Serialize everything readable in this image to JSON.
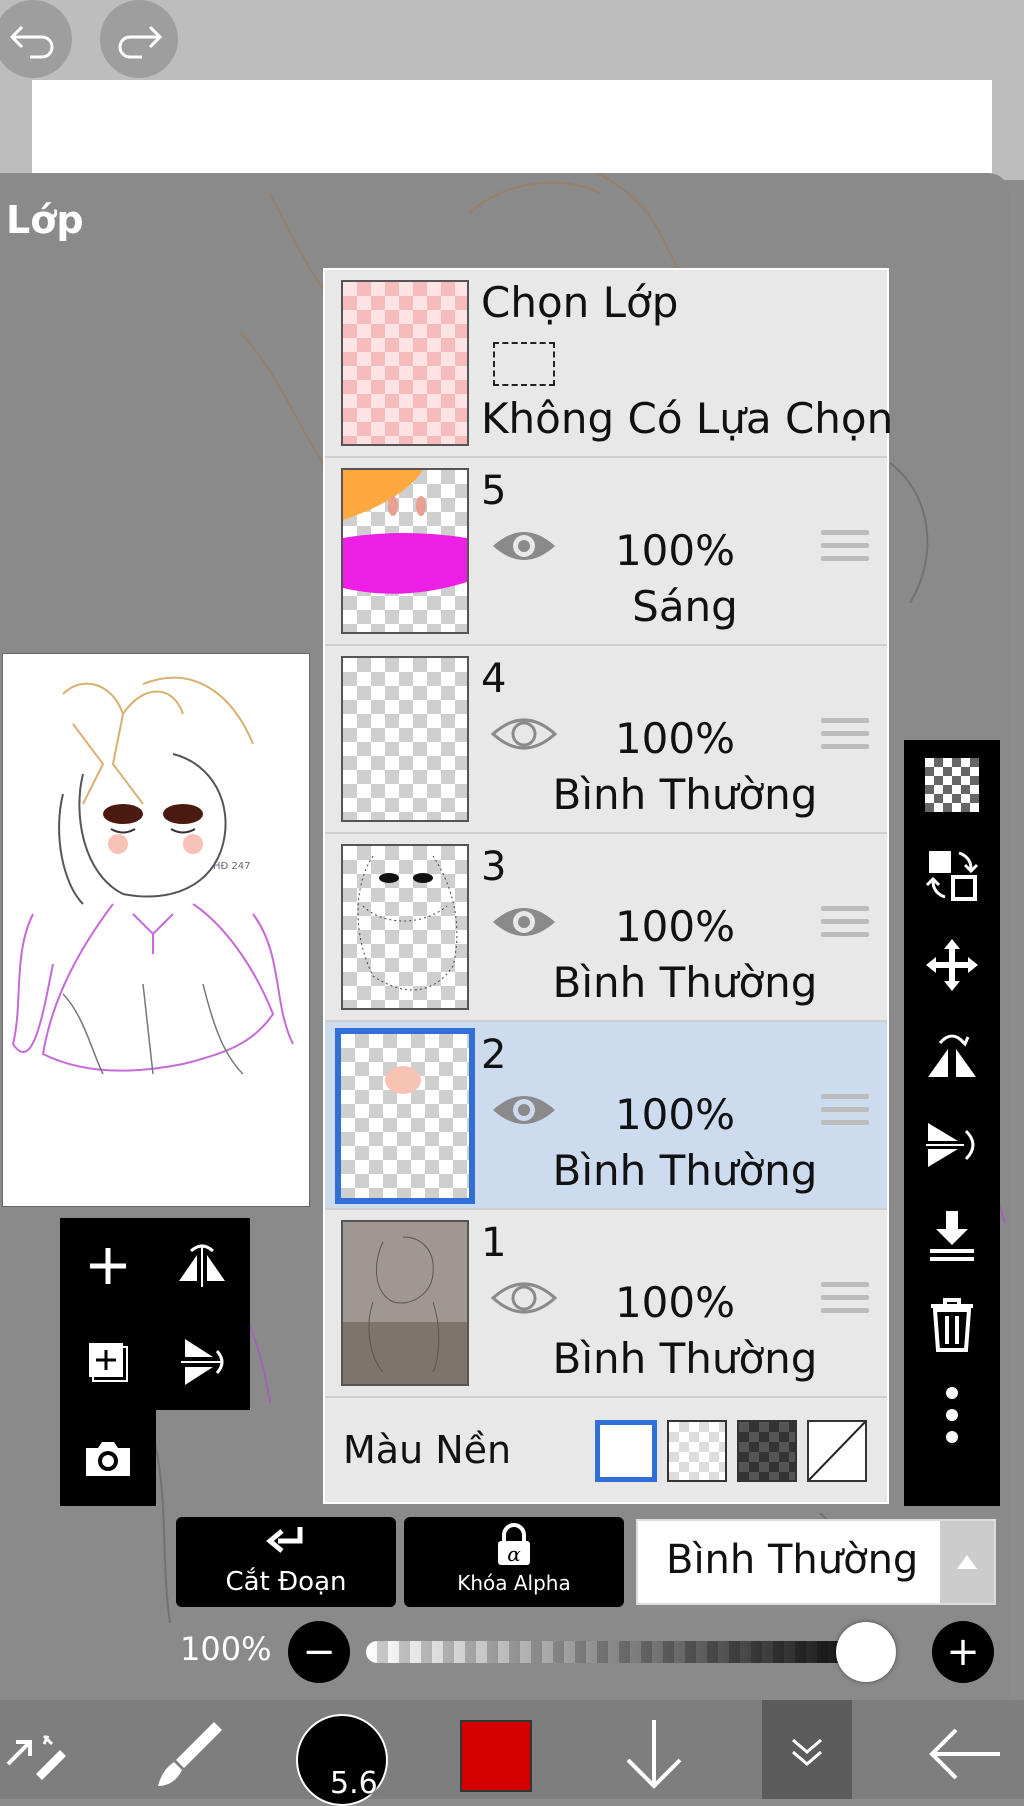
{
  "top": {
    "undo_icon": "undo-icon",
    "redo_icon": "redo-icon"
  },
  "panel": {
    "title": "Lớp"
  },
  "selection_layer": {
    "title": "Chọn Lớp",
    "status": "Không Có Lựa Chọn"
  },
  "layers": [
    {
      "number": "5",
      "opacity": "100%",
      "mode": "Sáng",
      "visible": true
    },
    {
      "number": "4",
      "opacity": "100%",
      "mode": "Bình Thường",
      "visible": false
    },
    {
      "number": "3",
      "opacity": "100%",
      "mode": "Bình Thường",
      "visible": true
    },
    {
      "number": "2",
      "opacity": "100%",
      "mode": "Bình Thường",
      "visible": true,
      "selected": true
    },
    {
      "number": "1",
      "opacity": "100%",
      "mode": "Bình Thường",
      "visible": false
    }
  ],
  "background_color": {
    "label": "Màu Nền"
  },
  "controls": {
    "clipping_label": "Cắt Đoạn",
    "alpha_lock_label": "Khóa Alpha",
    "blend_mode": "Bình Thường",
    "opacity_value": "100%",
    "opacity_fraction": 1.0
  },
  "bottom_bar": {
    "brush_size": "5.6",
    "color": "#d40000"
  },
  "colors": {
    "selected_row": "#cddbee",
    "selection_border": "#2f6fd6",
    "toolbar": "#000000"
  }
}
